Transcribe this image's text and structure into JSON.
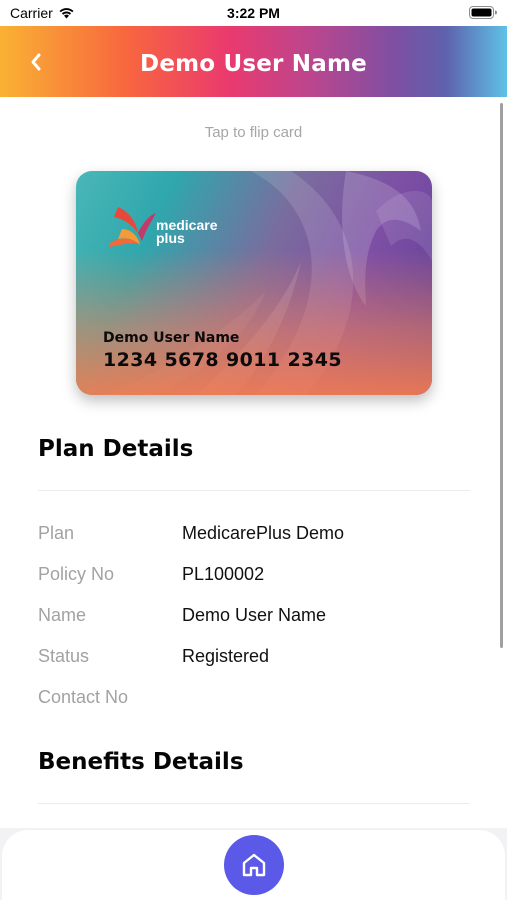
{
  "status_bar": {
    "carrier": "Carrier",
    "time": "3:22 PM"
  },
  "header": {
    "title": "Demo User Name",
    "back_icon": "chevron-left-icon"
  },
  "card": {
    "hint": "Tap to flip card",
    "brand_line1": "medicare",
    "brand_line2": "plus",
    "holder_name": "Demo User Name",
    "card_number": "1234 5678 9011 2345"
  },
  "plan_details": {
    "title": "Plan Details",
    "rows": [
      {
        "label": "Plan",
        "value": "MedicarePlus Demo"
      },
      {
        "label": "Policy No",
        "value": "PL100002"
      },
      {
        "label": "Name",
        "value": "Demo User Name"
      },
      {
        "label": "Status",
        "value": "Registered"
      },
      {
        "label": "Contact No",
        "value": ""
      }
    ]
  },
  "benefits_details": {
    "title": "Benefits Details"
  },
  "bottom_nav": {
    "home_icon": "home-icon",
    "accent_color": "#5b59e8"
  }
}
